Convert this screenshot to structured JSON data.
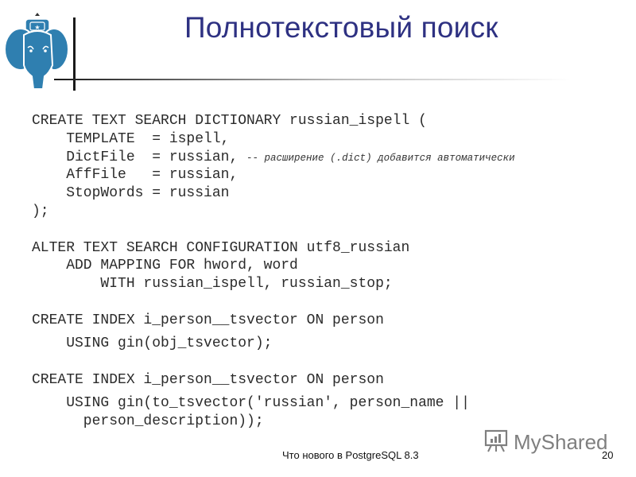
{
  "slide": {
    "title": "Полнотекстовый поиск",
    "code_blocks": [
      {
        "lines": [
          "CREATE TEXT SEARCH DICTIONARY russian_ispell (",
          "    TEMPLATE  = ispell,",
          "    DictFile  = russian, ",
          "    AffFile   = russian,",
          "    StopWords = russian",
          ");"
        ],
        "comment": "-- расширение (.dict) добавится автоматически"
      },
      {
        "lines": [
          "ALTER TEXT SEARCH CONFIGURATION utf8_russian",
          "    ADD MAPPING FOR hword, word",
          "        WITH russian_ispell, russian_stop;"
        ]
      },
      {
        "lines": [
          "CREATE INDEX i_person__tsvector ON person",
          "    USING gin(obj_tsvector);"
        ]
      },
      {
        "lines": [
          "CREATE INDEX i_person__tsvector ON person",
          "    USING gin(to_tsvector('russian', person_name ||",
          "      person_description));"
        ]
      }
    ]
  },
  "footer": {
    "text": "Что нового в PostgreSQL 8.3",
    "page_number": "20"
  },
  "watermark": {
    "text": "MyShared",
    "icon": "presentation-chart-icon"
  },
  "logo": {
    "icon": "postgresql-elephant-icon",
    "color": "#2f7fb0"
  },
  "colors": {
    "title": "#2e3182",
    "code": "#2b2b2b"
  }
}
